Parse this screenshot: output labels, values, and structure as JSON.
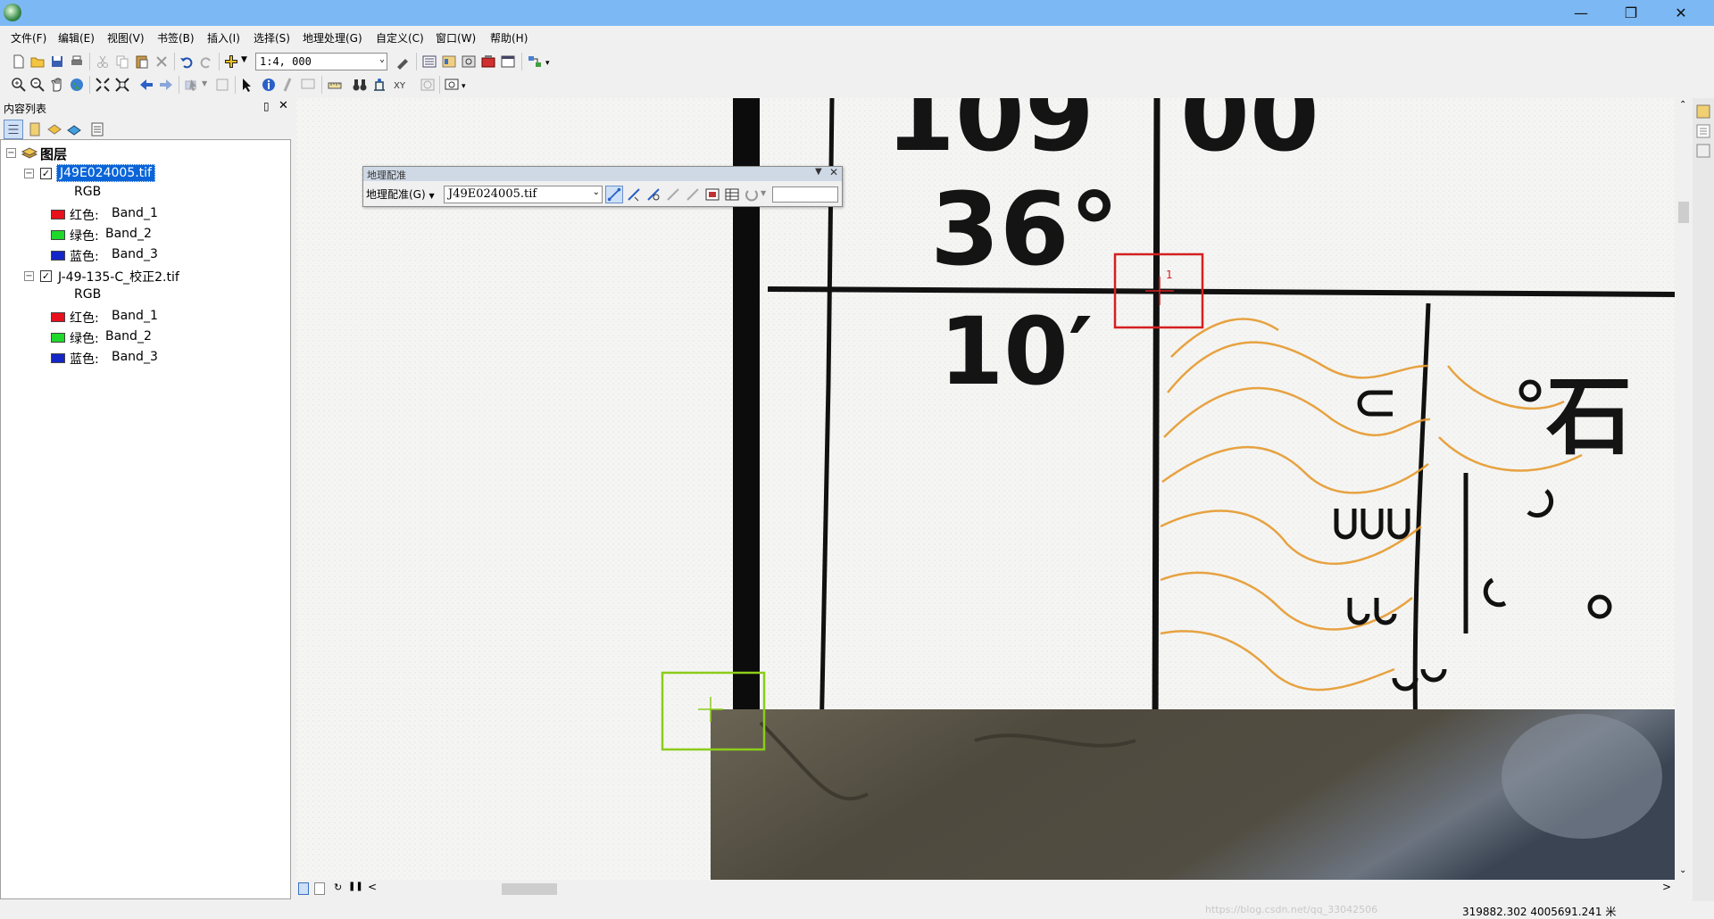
{
  "menubar": {
    "items": [
      "文件(F)",
      "编辑(E)",
      "视图(V)",
      "书签(B)",
      "插入(I)",
      "选择(S)",
      "地理处理(G)",
      "自定义(C)",
      "窗口(W)",
      "帮助(H)"
    ]
  },
  "toolbar": {
    "scale_value": "1:4, 000"
  },
  "toc": {
    "title": "内容列表",
    "root_label": "图层",
    "layers": [
      {
        "name": "J49E024005.tif",
        "selected": true,
        "checked": true,
        "rgb_label": "RGB",
        "bands": [
          {
            "color_label": "红色:",
            "band": "Band_1",
            "swatch": "#e8101c"
          },
          {
            "color_label": "绿色:",
            "band": "Band_2",
            "swatch": "#1ed82a"
          },
          {
            "color_label": "蓝色:",
            "band": "Band_3",
            "swatch": "#1426c8"
          }
        ]
      },
      {
        "name": "J-49-135-C_校正2.tif",
        "selected": false,
        "checked": true,
        "rgb_label": "RGB",
        "bands": [
          {
            "color_label": "红色:",
            "band": "Band_1",
            "swatch": "#e8101c"
          },
          {
            "color_label": "绿色:",
            "band": "Band_2",
            "swatch": "#1ed82a"
          },
          {
            "color_label": "蓝色:",
            "band": "Band_3",
            "swatch": "#1426c8"
          }
        ]
      }
    ]
  },
  "georef_toolbar": {
    "title": "地理配准",
    "menu_label": "地理配准(G)",
    "layer_value": "J49E024005.tif"
  },
  "map": {
    "labels": {
      "lon_deg": "109",
      "lon_min": "00",
      "lat_deg": "36°",
      "lat_min": "10′",
      "place_char": "石"
    },
    "control_point_label": "1"
  },
  "status": {
    "coords": "319882.302  4005691.241 米",
    "watermark": "https://blog.csdn.net/qq_33042506"
  },
  "colors": {
    "titlebar": "#7cb9f4",
    "selection": "#0a64d8",
    "contour": "#e69a2e",
    "source_link_box": "#d42020",
    "target_link_box": "#8ccc1a"
  }
}
